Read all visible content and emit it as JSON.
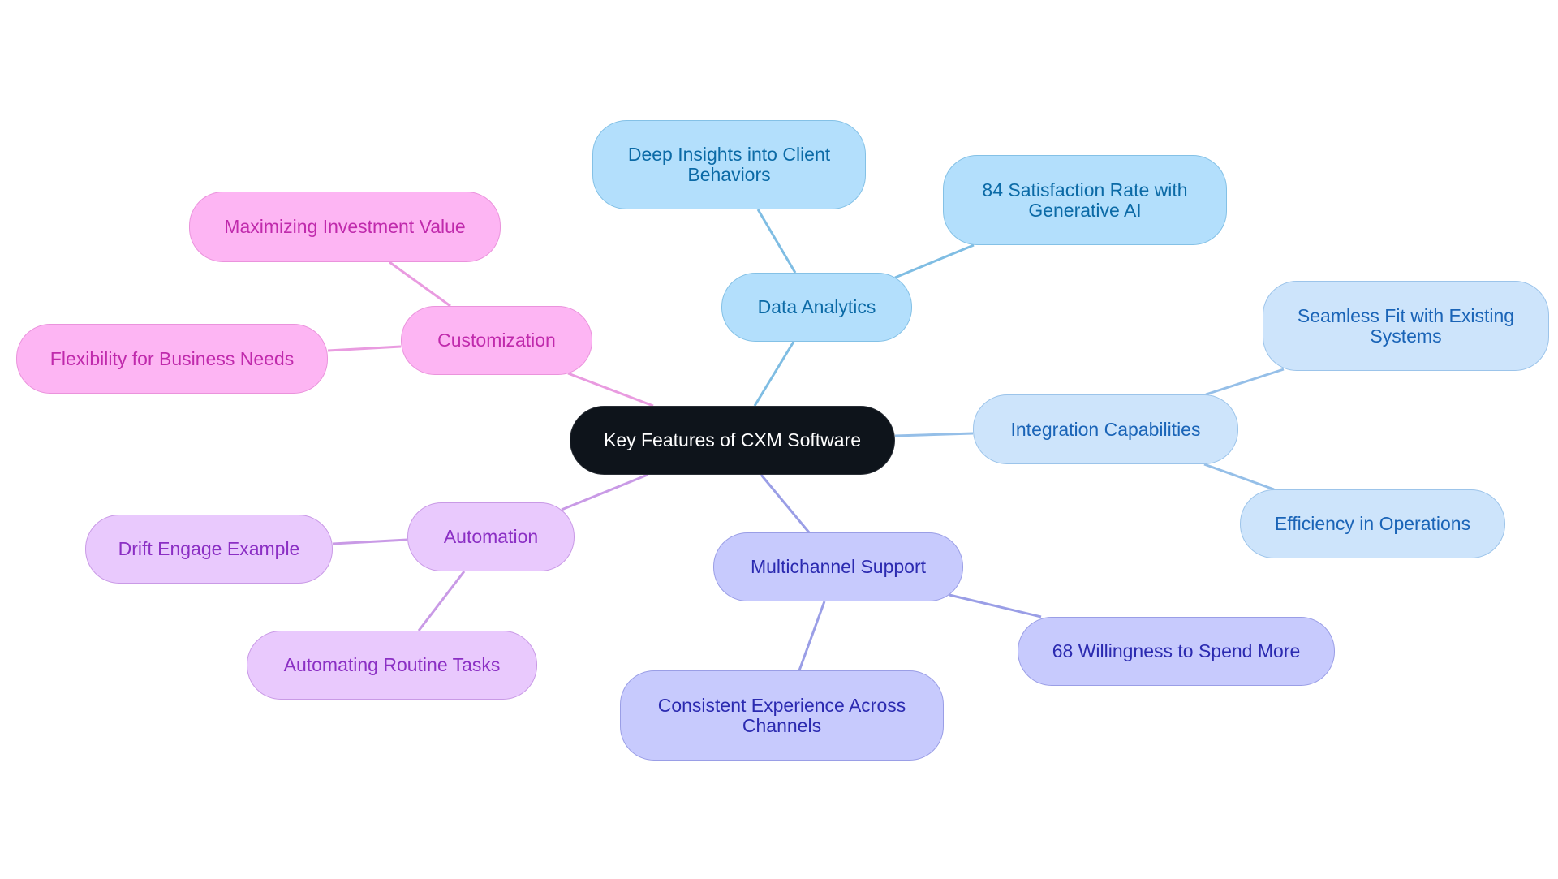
{
  "title": "Key Features of CXM Software",
  "colors": {
    "root_fill": "#0e141b",
    "data_analytics": "#b3dffc",
    "integration": "#cde4fb",
    "multichannel": "#c7cafd",
    "customization": "#fdb5f3",
    "automation": "#e9c9fd",
    "edge_data_analytics": "#7fbde3",
    "edge_integration": "#95bfe8",
    "edge_multichannel": "#9a9ee6",
    "edge_customization": "#e99be0",
    "edge_automation": "#c99ae6"
  },
  "root": {
    "label": "Key Features of CXM Software"
  },
  "branches": [
    {
      "id": "data-analytics",
      "label": "Data Analytics",
      "children": [
        "Deep Insights into Client Behaviors",
        "84 Satisfaction Rate with Generative AI"
      ]
    },
    {
      "id": "integration-capabilities",
      "label": "Integration Capabilities",
      "children": [
        "Seamless Fit with Existing Systems",
        "Efficiency in Operations"
      ]
    },
    {
      "id": "multichannel-support",
      "label": "Multichannel Support",
      "children": [
        "68 Willingness to Spend More",
        "Consistent Experience Across Channels"
      ]
    },
    {
      "id": "customization",
      "label": "Customization",
      "children": [
        "Maximizing Investment Value",
        "Flexibility for Business Needs"
      ]
    },
    {
      "id": "automation",
      "label": "Automation",
      "children": [
        "Drift Engage Example",
        "Automating Routine Tasks"
      ]
    }
  ]
}
